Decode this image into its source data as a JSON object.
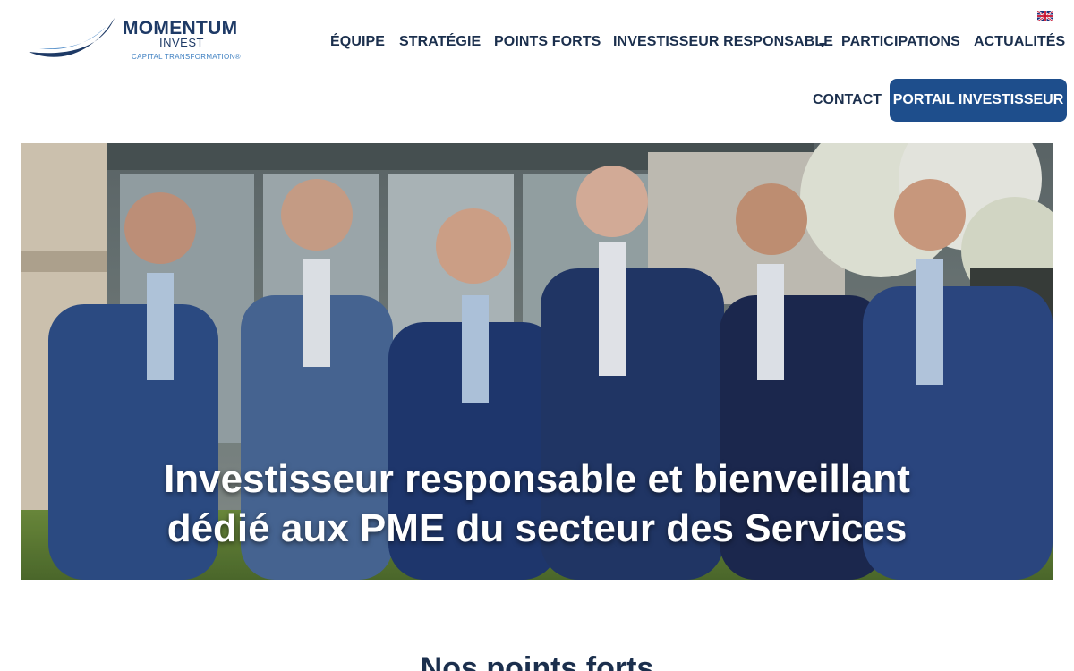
{
  "header": {
    "logo": {
      "name": "MOMENTUM",
      "sub": "INVEST",
      "tagline": "CAPITAL TRANSFORMATION®"
    },
    "language_icon": "uk-flag-icon",
    "nav": [
      {
        "label": "ÉQUIPE"
      },
      {
        "label": "STRATÉGIE"
      },
      {
        "label": "POINTS FORTS"
      },
      {
        "label": "INVESTISSEUR RESPONSABLE"
      },
      {
        "label": "PARTICIPATIONS"
      },
      {
        "label": "ACTUALITÉS"
      }
    ],
    "contact_label": "CONTACT",
    "portal_label": "PORTAIL INVESTISSEUR"
  },
  "hero": {
    "title_line1": "Investisseur responsable et bienveillant",
    "title_line2": "dédié aux PME du secteur des Services"
  },
  "section": {
    "heading": "Nos points forts"
  },
  "colors": {
    "brand_navy": "#1b2f4d",
    "button_blue": "#1e4e8c",
    "accent_blue": "#3d7fc1"
  }
}
